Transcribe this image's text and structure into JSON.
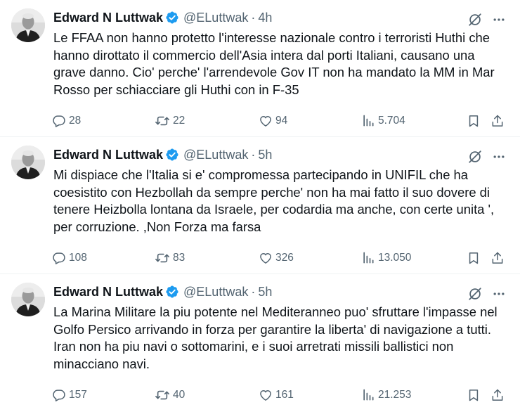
{
  "tweets": [
    {
      "name": "Edward N Luttwak",
      "handle": "@ELuttwak",
      "separator": "·",
      "time": "4h",
      "text": "Le FFAA non hanno protetto l'interesse nazionale contro i terroristi Huthi che hanno dirottato il commercio dell'Asia intera dal porti Italiani, causano una grave danno. Cio' perche' l'arrendevole Gov IT non ha mandato la MM in Mar Rosso per schiacciare gli Huthi con in F-35",
      "replies": "28",
      "reposts": "22",
      "likes": "94",
      "views": "5.704"
    },
    {
      "name": "Edward N Luttwak",
      "handle": "@ELuttwak",
      "separator": "·",
      "time": "5h",
      "text": "Mi dispiace che l'Italia si e' compromessa partecipando in UNIFIL che ha coesistito con Hezbollah da sempre perche' non ha mai fatto il suo dovere di tenere Heizbolla lontana da Israele, per codardia ma anche, con certe unita ', per corruzione. ,Non Forza ma farsa",
      "replies": "108",
      "reposts": "83",
      "likes": "326",
      "views": "13.050"
    },
    {
      "name": "Edward N Luttwak",
      "handle": "@ELuttwak",
      "separator": "·",
      "time": "5h",
      "text": "La Marina Militare la piu potente nel Mediteranneo  puo' sfruttare l'impasse nel Golfo Persico arrivando in forza per garantire la liberta' di navigazione a tutti. Iran non ha piu navi o sottomarini, e i suoi arretrati missili ballistici non minacciano navi.",
      "replies": "157",
      "reposts": "40",
      "likes": "161",
      "views": "21.253"
    }
  ],
  "colors": {
    "text": "#0f1419",
    "secondary": "#536471",
    "verified": "#1d9bf0",
    "divider": "#eff3f4"
  },
  "icons": {
    "verified": "verified-badge-icon",
    "grok": "grok-icon",
    "more": "more-icon",
    "reply": "reply-icon",
    "repost": "repost-icon",
    "like": "like-icon",
    "views": "views-icon",
    "bookmark": "bookmark-icon",
    "share": "share-icon"
  }
}
